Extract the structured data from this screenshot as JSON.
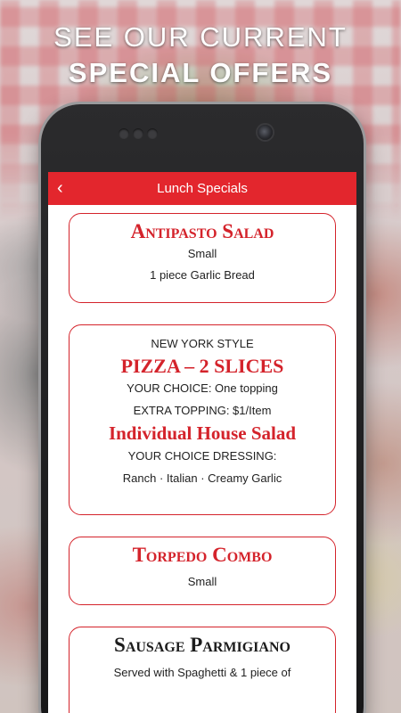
{
  "promo": {
    "line1": "SEE OUR CURRENT",
    "line2": "SPECIAL OFFERS"
  },
  "appbar": {
    "back_icon": "chevron-left-icon",
    "back_glyph": "‹",
    "title": "Lunch Specials"
  },
  "colors": {
    "accent": "#e3262d",
    "card_border": "#d4232b",
    "headline_text": "#ffffff"
  },
  "specials": [
    {
      "name": "Antipasto Salad",
      "details": [
        "Small",
        "1 piece Garlic Bread"
      ]
    },
    {
      "overline": "NEW YORK STYLE",
      "name": "PIZZA – 2 SLICES",
      "details": [
        "YOUR CHOICE: One topping",
        "EXTRA TOPPING: $1/Item"
      ],
      "side_name": "Individual House Salad",
      "side_details": [
        "YOUR CHOICE DRESSING:",
        "Ranch · Italian · Creamy Garlic"
      ]
    },
    {
      "name": "Torpedo Combo",
      "details": [
        "Small"
      ]
    },
    {
      "name": "Sausage Parmigiano",
      "details": [
        "Served with Spaghetti & 1 piece of"
      ]
    }
  ]
}
